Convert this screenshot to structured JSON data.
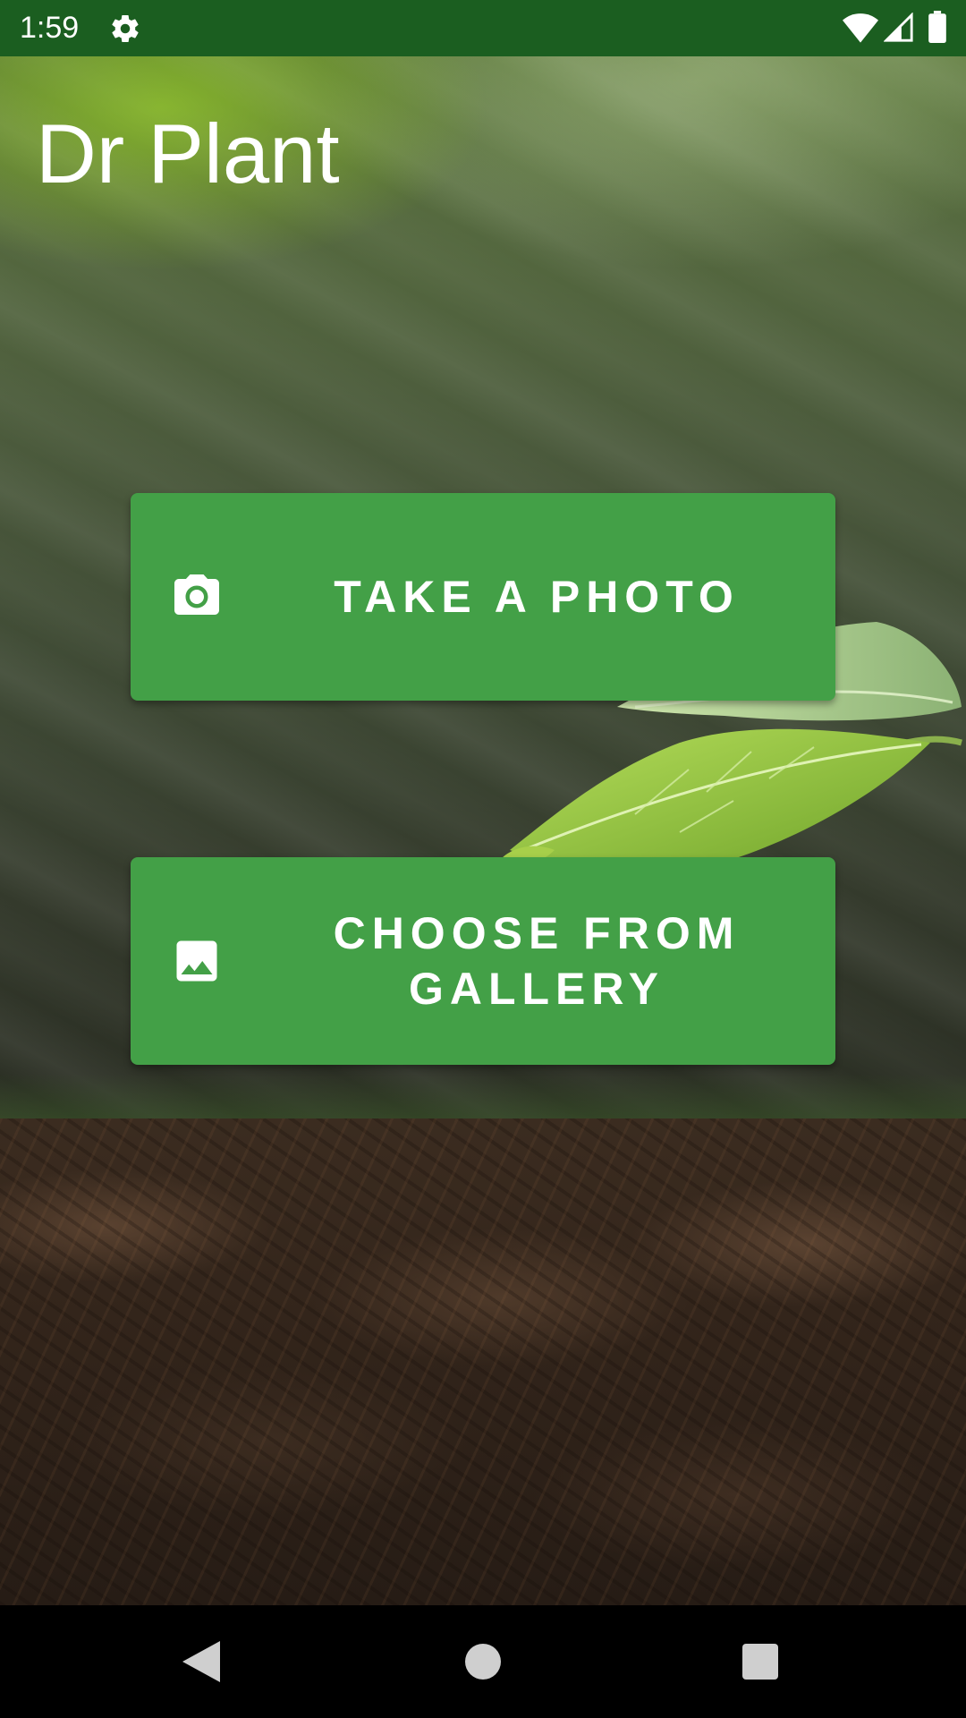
{
  "status_bar": {
    "time": "1:59",
    "icons": [
      "settings-gear-icon",
      "wifi-icon",
      "cellular-signal-icon",
      "battery-icon"
    ],
    "background_color": "#1b5e20"
  },
  "app": {
    "title": "Dr Plant"
  },
  "actions": {
    "take_photo": {
      "label": "TAKE A PHOTO",
      "icon": "camera-icon"
    },
    "choose_gallery": {
      "label": "CHOOSE FROM\nGALLERY",
      "icon": "image-icon"
    },
    "button_color": "#43a047"
  },
  "navigation": {
    "icons": [
      "back-icon",
      "home-icon",
      "recents-icon"
    ]
  }
}
